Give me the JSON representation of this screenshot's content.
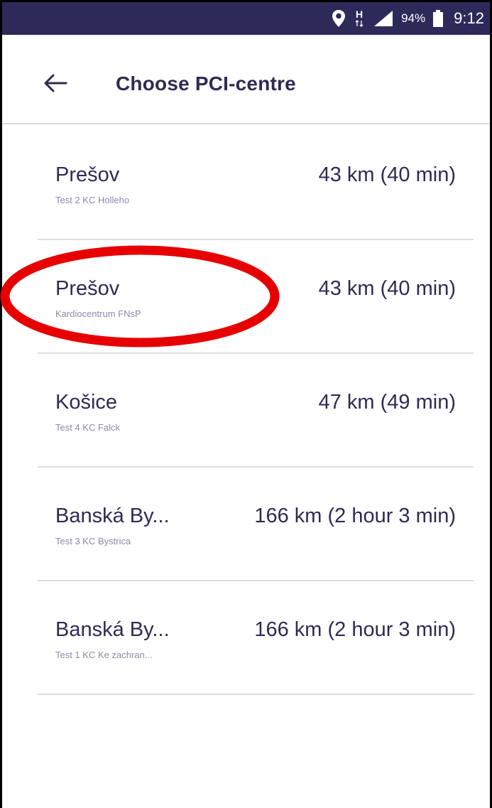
{
  "status_bar": {
    "network_label": "H",
    "battery_percent": "94%",
    "time": "9:12",
    "icons": [
      "location-icon",
      "network-icon",
      "signal-icon",
      "battery-icon"
    ]
  },
  "header": {
    "back_icon": "arrow-left-icon",
    "title": "Choose PCI-centre"
  },
  "centres": [
    {
      "city": "Prešov",
      "center": "Test 2 KC Holleho",
      "distance": "43 km (40 min)"
    },
    {
      "city": "Prešov",
      "center": "Kardiocentrum FNsP",
      "distance": "43 km (40 min)"
    },
    {
      "city": "Košice",
      "center": "Test 4 KC Falck",
      "distance": "47 km (49 min)"
    },
    {
      "city": "Banská By...",
      "center": "Test 3 KC Bystrica",
      "distance": "166 km (2 hour 3 min)"
    },
    {
      "city": "Banská By...",
      "center": "Test 1 KC Ke zachran...",
      "distance": "166 km (2 hour 3 min)"
    }
  ],
  "colors": {
    "status_bar": "#2d2a5a",
    "text_primary": "#2e2b54",
    "text_secondary": "#8c8aa8",
    "annotation": "#e60000"
  }
}
